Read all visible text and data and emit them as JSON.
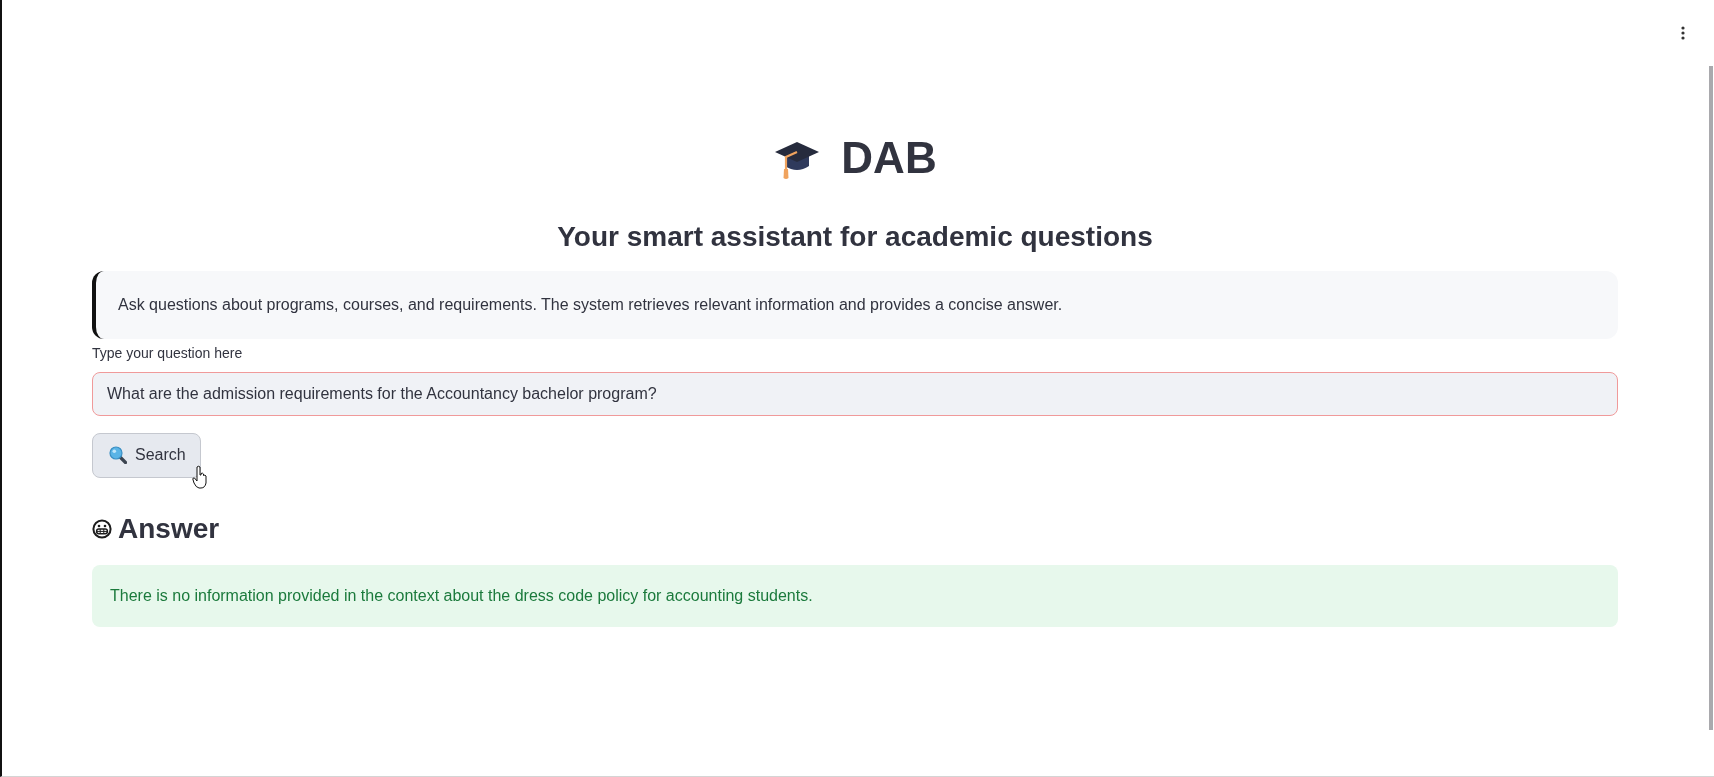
{
  "header": {
    "title": "DAB",
    "subtitle": "Your smart assistant for academic questions"
  },
  "info": {
    "text": "Ask questions about programs, courses, and requirements. The system retrieves relevant information and provides a concise answer."
  },
  "question": {
    "label": "Type your question here",
    "value": "What are the admission requirements for the Accountancy bachelor program?",
    "focused": true
  },
  "search_button": {
    "label": "Search"
  },
  "answer": {
    "heading": "Answer",
    "text": "There is no information provided in the context about the dress code policy for accounting students."
  }
}
